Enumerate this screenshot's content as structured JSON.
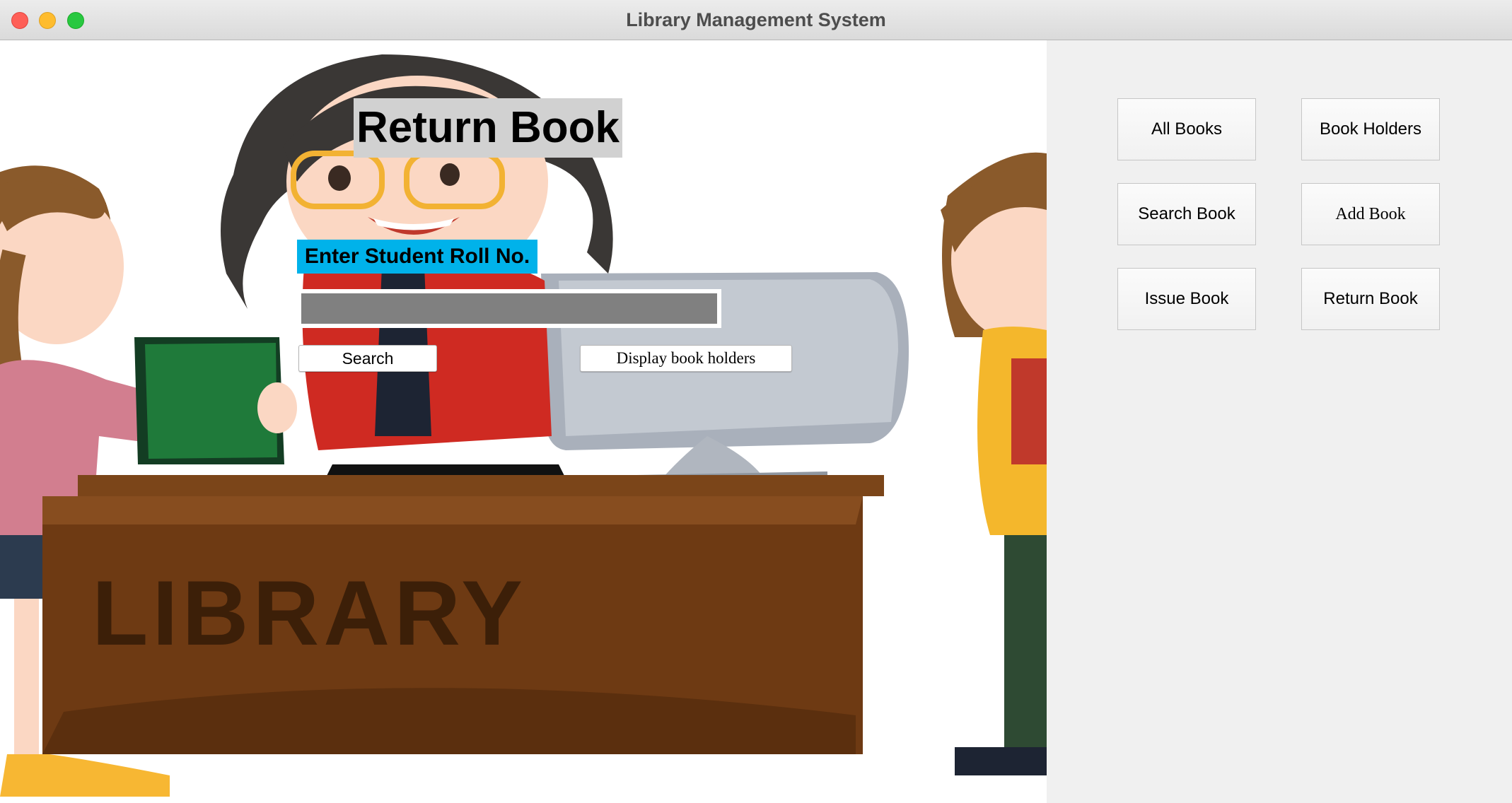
{
  "window": {
    "title": "Library Management System"
  },
  "main": {
    "heading": "Return Book",
    "roll_label": "Enter Student Roll No.",
    "roll_input_value": "",
    "search_button": "Search",
    "display_button": "Display book holders",
    "background_desk_text": "LIBRARY"
  },
  "sidebar": {
    "buttons": [
      {
        "label": "All Books"
      },
      {
        "label": "Book Holders"
      },
      {
        "label": "Search Book"
      },
      {
        "label": "Add Book"
      },
      {
        "label": "Issue Book"
      },
      {
        "label": "Return Book"
      }
    ]
  },
  "colors": {
    "roll_label_bg": "#00b2ea",
    "heading_bg": "#d1d1d1",
    "input_bg": "#808080",
    "side_panel_bg": "#f0f0f0",
    "desk": "#6e3a13"
  }
}
